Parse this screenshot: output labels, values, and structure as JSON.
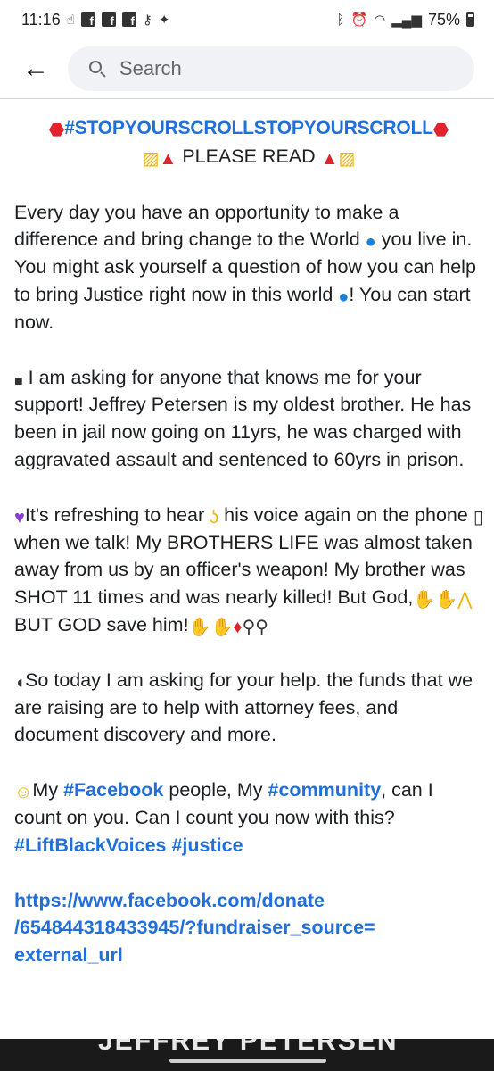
{
  "status_bar": {
    "time": "11:16",
    "battery_percent": "75%"
  },
  "search": {
    "placeholder": "Search"
  },
  "post": {
    "title_hashtag": "#STOPYOURSCROLLSTOPYOURSCROLL",
    "please_read": "PLEASE READ",
    "para1": {
      "a": "Every day you have an opportunity to make a difference and bring change to the World ",
      "b": " you live in. You might ask yourself a question of how you can help to bring Justice right now in this world ",
      "c": "! You can start now."
    },
    "para2": "I am asking for anyone that knows me for your support! Jeffrey Petersen is my oldest brother. He has been in jail now going on 11yrs, he was charged with aggravated assault and sentenced to 60yrs in prison.",
    "para3": {
      "a": "It's refreshing to hear ",
      "b": " his voice again on the phone ",
      "c": " when we talk! My BROTHERS LIFE was almost taken away from us by an officer's weapon! My brother was SHOT 11 times and was nearly killed! But God,",
      "d": " BUT GOD save him!"
    },
    "para4": "So today I am asking for your help. the funds that we are raising are to help with attorney fees, and document discovery and more.",
    "para5": {
      "a": "My ",
      "hashtag_facebook": "#Facebook",
      "b": " people, My ",
      "hashtag_community": "#community",
      "c": ", can I count on you. Can I count you now with this?",
      "hashtag_liftblackvoices": "#LiftBlackVoices",
      "hashtag_justice": "#justice"
    },
    "link": {
      "line1": "https://www.facebook.com/donate",
      "line2": "/654844318433945/?fundraiser_source=",
      "line3": "external_url"
    }
  },
  "bottom_image": {
    "visible_text": "JEFFREY PETERSEN"
  },
  "icons": [
    "back-arrow-icon",
    "search-icon",
    "stop-sign-icon",
    "construction-sign-icon",
    "police-light-icon",
    "globe-icon",
    "black-square-icon",
    "purple-heart-icon",
    "ear-icon",
    "mobile-phone-icon",
    "clapping-hands-icon",
    "praying-hands-icon",
    "raised-hands-icon",
    "dancer-icon",
    "walking-person-icon",
    "running-person-icon",
    "speaking-head-icon",
    "family-icon"
  ],
  "colors": {
    "link_blue": "#216fdb",
    "search_bg": "#f0f2f5",
    "text": "#1c1e21"
  }
}
